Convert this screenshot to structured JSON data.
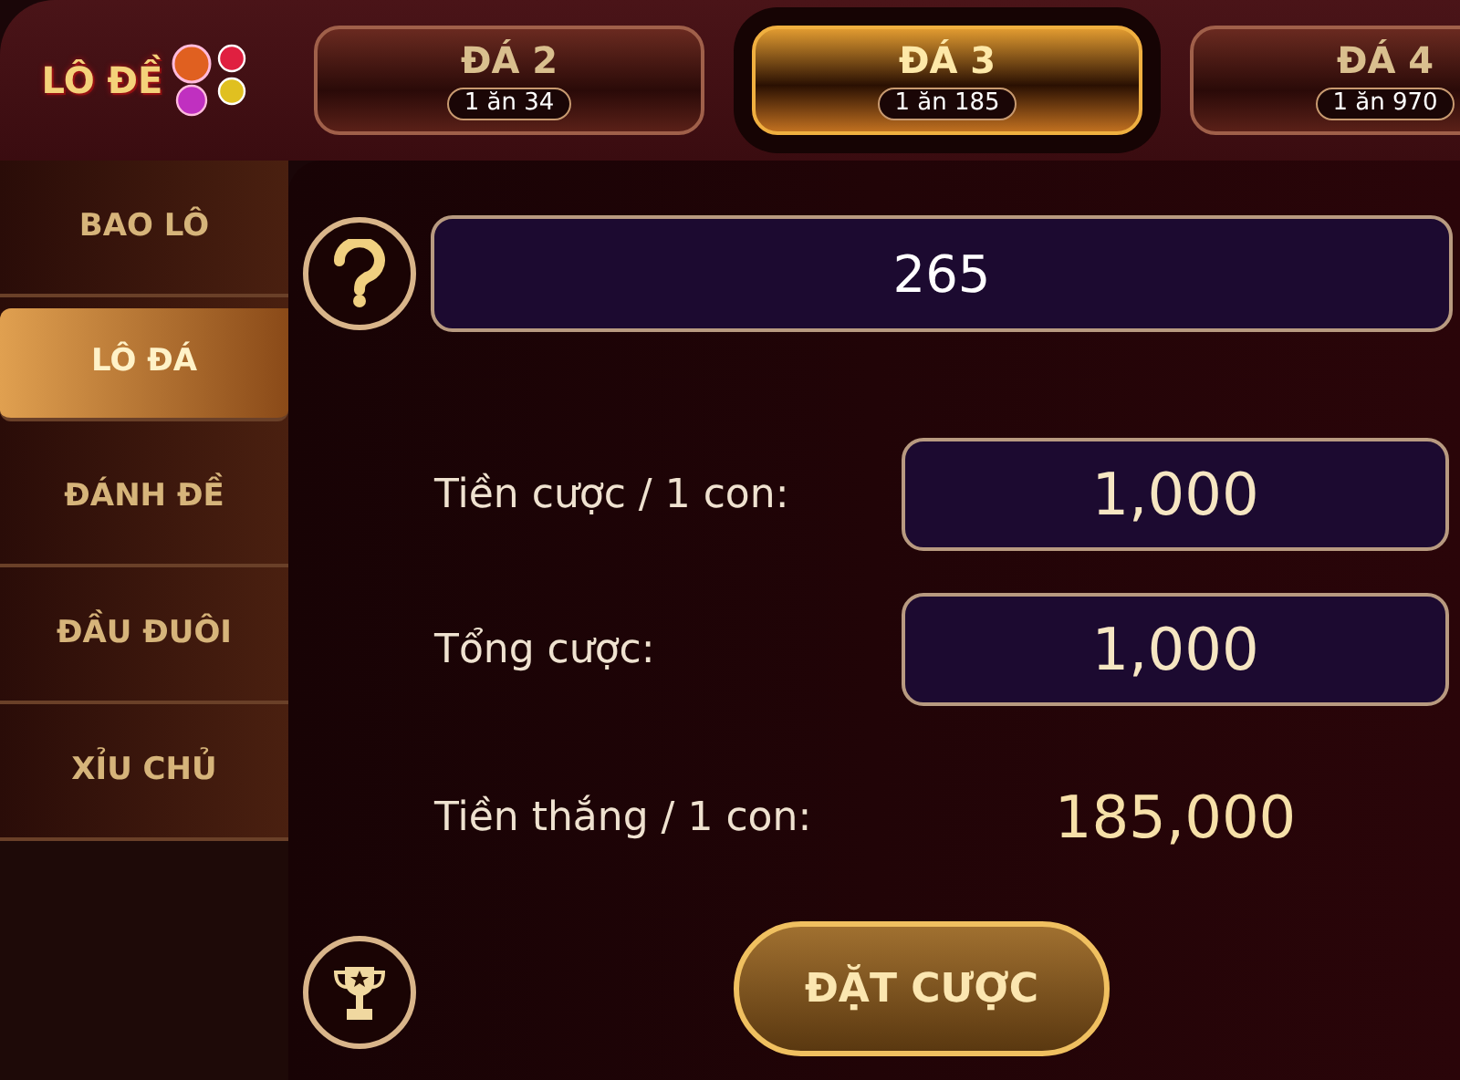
{
  "logo": {
    "text": "LÔ ĐỀ"
  },
  "tabs": [
    {
      "title": "ĐÁ 2",
      "odds": "1 ăn 34",
      "selected": false
    },
    {
      "title": "ĐÁ 3",
      "odds": "1 ăn 185",
      "selected": true
    },
    {
      "title": "ĐÁ 4",
      "odds": "1 ăn 970",
      "selected": false
    }
  ],
  "sidebar": {
    "items": [
      {
        "label": "BAO LÔ",
        "selected": false
      },
      {
        "label": "LÔ ĐÁ",
        "selected": true
      },
      {
        "label": "ĐÁNH ĐỀ",
        "selected": false
      },
      {
        "label": "ĐẦU ĐUÔI",
        "selected": false
      },
      {
        "label": "XỈU CHỦ",
        "selected": false
      }
    ]
  },
  "number_field": {
    "value": "265"
  },
  "form_rows": [
    {
      "kind": "field",
      "label": "Tiền cược / 1 con:",
      "value": "1,000"
    },
    {
      "kind": "field",
      "label": "Tổng cược:",
      "value": "1,000"
    },
    {
      "kind": "text",
      "label": "Tiền thắng / 1 con:",
      "value": "185,000"
    }
  ],
  "submit_button": "ĐẶT CƯỢC"
}
